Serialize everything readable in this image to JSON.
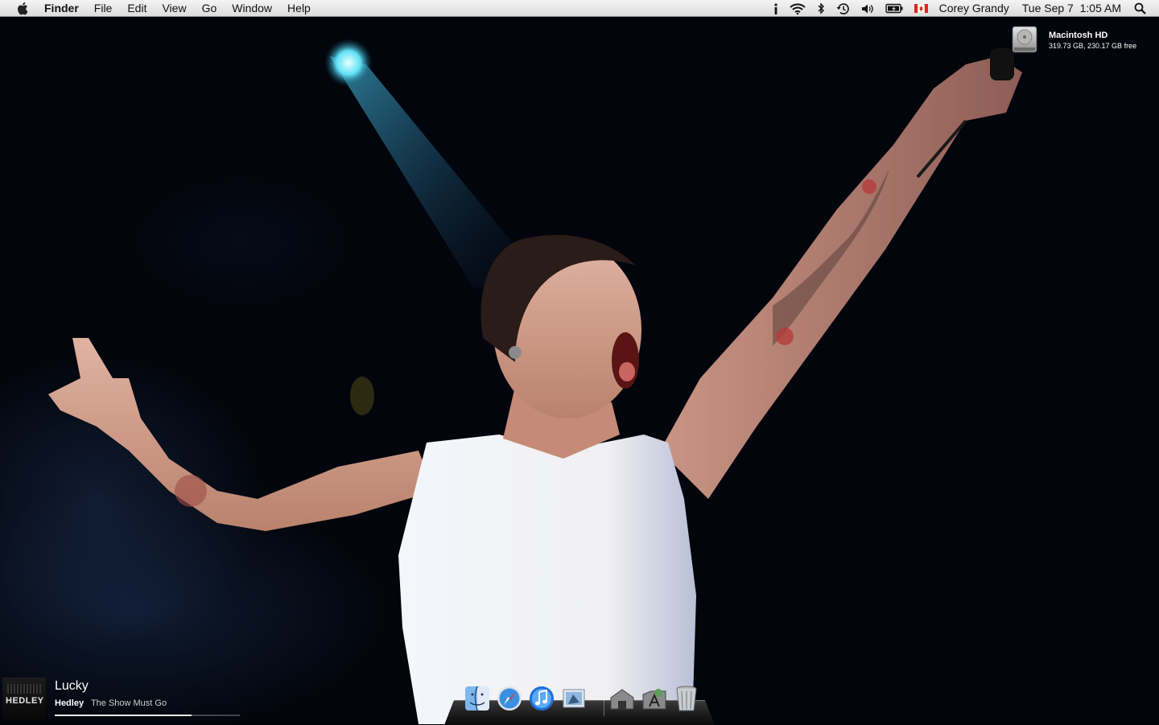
{
  "menubar": {
    "app_name": "Finder",
    "menus": [
      "File",
      "Edit",
      "View",
      "Go",
      "Window",
      "Help"
    ],
    "status_icons": [
      "info-icon",
      "wifi-icon",
      "bluetooth-icon",
      "time-machine-icon",
      "volume-icon",
      "battery-icon",
      "canada-flag-icon"
    ],
    "user_name": "Corey Grandy",
    "datetime": "Tue Sep 7  1:05 AM"
  },
  "desktop": {
    "disk": {
      "name": "Macintosh HD",
      "info": "319.73 GB, 230.17 GB free"
    }
  },
  "now_playing": {
    "art_text": "HEDLEY",
    "title": "Lucky",
    "artist": "Hedley",
    "album": "The Show Must Go",
    "progress": 0.74
  },
  "dock": {
    "items": [
      "finder-icon",
      "safari-icon",
      "itunes-icon",
      "mail-icon",
      "home-folder-icon",
      "applications-folder-icon",
      "trash-icon"
    ]
  },
  "colors": {
    "menubar_top": "#f4f4f4",
    "menubar_bottom": "#dcdcdc",
    "spotlight": "#38c8e8",
    "flag_red": "#d52b1e"
  }
}
